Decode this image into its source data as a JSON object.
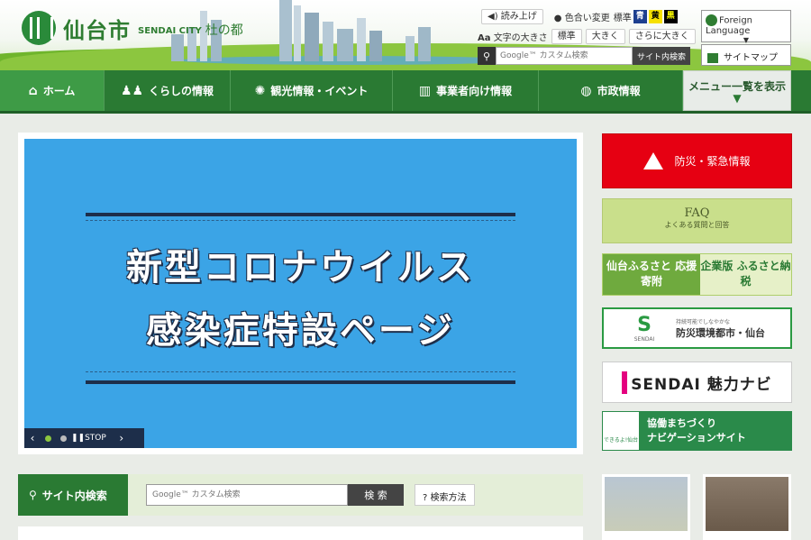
{
  "logo": {
    "name": "仙台市",
    "sub": "SENDAI CITY",
    "sub2": "杜の都"
  },
  "tools": {
    "read_aloud": "読み上げ",
    "color_label": "色合い変更",
    "color_standard": "標準",
    "color_blue": "青",
    "color_yellow": "黄",
    "color_black": "黒",
    "text_size_label": "文字の大きさ",
    "size_standard": "標準",
    "size_large": "大きく",
    "size_larger": "さらに大きく"
  },
  "search": {
    "placeholder": "Google™ カスタム検索",
    "button": "サイト内検索"
  },
  "lang": {
    "label": "Foreign Language"
  },
  "sitemap": {
    "label": "サイトマップ"
  },
  "nav": {
    "home": "ホーム",
    "living": "くらしの情報",
    "tourism": "観光情報・イベント",
    "business": "事業者向け情報",
    "city": "市政情報",
    "menu": "メニュー一覧を表示"
  },
  "banner": {
    "line1": "新型コロナウイルス",
    "line2": "感染症特設ページ",
    "stop": "STOP"
  },
  "side": {
    "bousai": "防災・緊急情報",
    "faq_title": "FAQ",
    "faq_sub": "よくある質問と回答",
    "furusato_left": "仙台ふるさと 応援寄附",
    "furusato_right": "企業版 ふるさと納税",
    "env_small": "持続可能でしなやかな",
    "env_logo": "SENDAI",
    "env_title": "防災環境都市・仙台",
    "sendai_nav": "SENDAI 魅力ナビ",
    "kyodo_icon": "できるよ!仙台",
    "kyodo_line1": "協働まちづくり",
    "kyodo_line2": "ナビゲーションサイト"
  },
  "site_search": {
    "label": "サイト内検索",
    "placeholder": "Google™ カスタム検索",
    "button": "検 索",
    "howto": "検索方法"
  },
  "colors": {
    "nav_green": "#2a7a33",
    "banner_blue": "#3ba4e6",
    "alert_red": "#e60012"
  }
}
